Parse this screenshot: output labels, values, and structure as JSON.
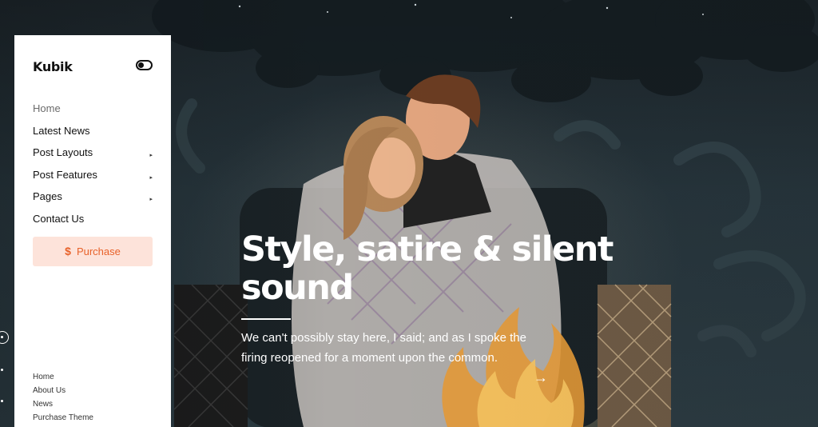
{
  "sidebar": {
    "logo": "Kubik",
    "theme_toggle_icon": "toggle-switch-icon",
    "menu": [
      {
        "label": "Home",
        "active": true,
        "has_submenu": false
      },
      {
        "label": "Latest News",
        "active": false,
        "has_submenu": false
      },
      {
        "label": "Post Layouts",
        "active": false,
        "has_submenu": true
      },
      {
        "label": "Post Features",
        "active": false,
        "has_submenu": true
      },
      {
        "label": "Pages",
        "active": false,
        "has_submenu": true
      },
      {
        "label": "Contact Us",
        "active": false,
        "has_submenu": false
      }
    ],
    "submenu_caret": "▸",
    "purchase": {
      "icon": "$",
      "label": "Purchase"
    },
    "footer_links": [
      "Home",
      "About Us",
      "News",
      "Purchase Theme"
    ]
  },
  "hero": {
    "title": "Style, satire & silent sound",
    "excerpt": "We can't possibly stay here, I said; and as I spoke the firing reopened for a moment upon the common.",
    "arrow": "→"
  },
  "colors": {
    "accent": "#e8622a",
    "accent_bg": "#fde3da",
    "hero_bg": "#26343b"
  }
}
